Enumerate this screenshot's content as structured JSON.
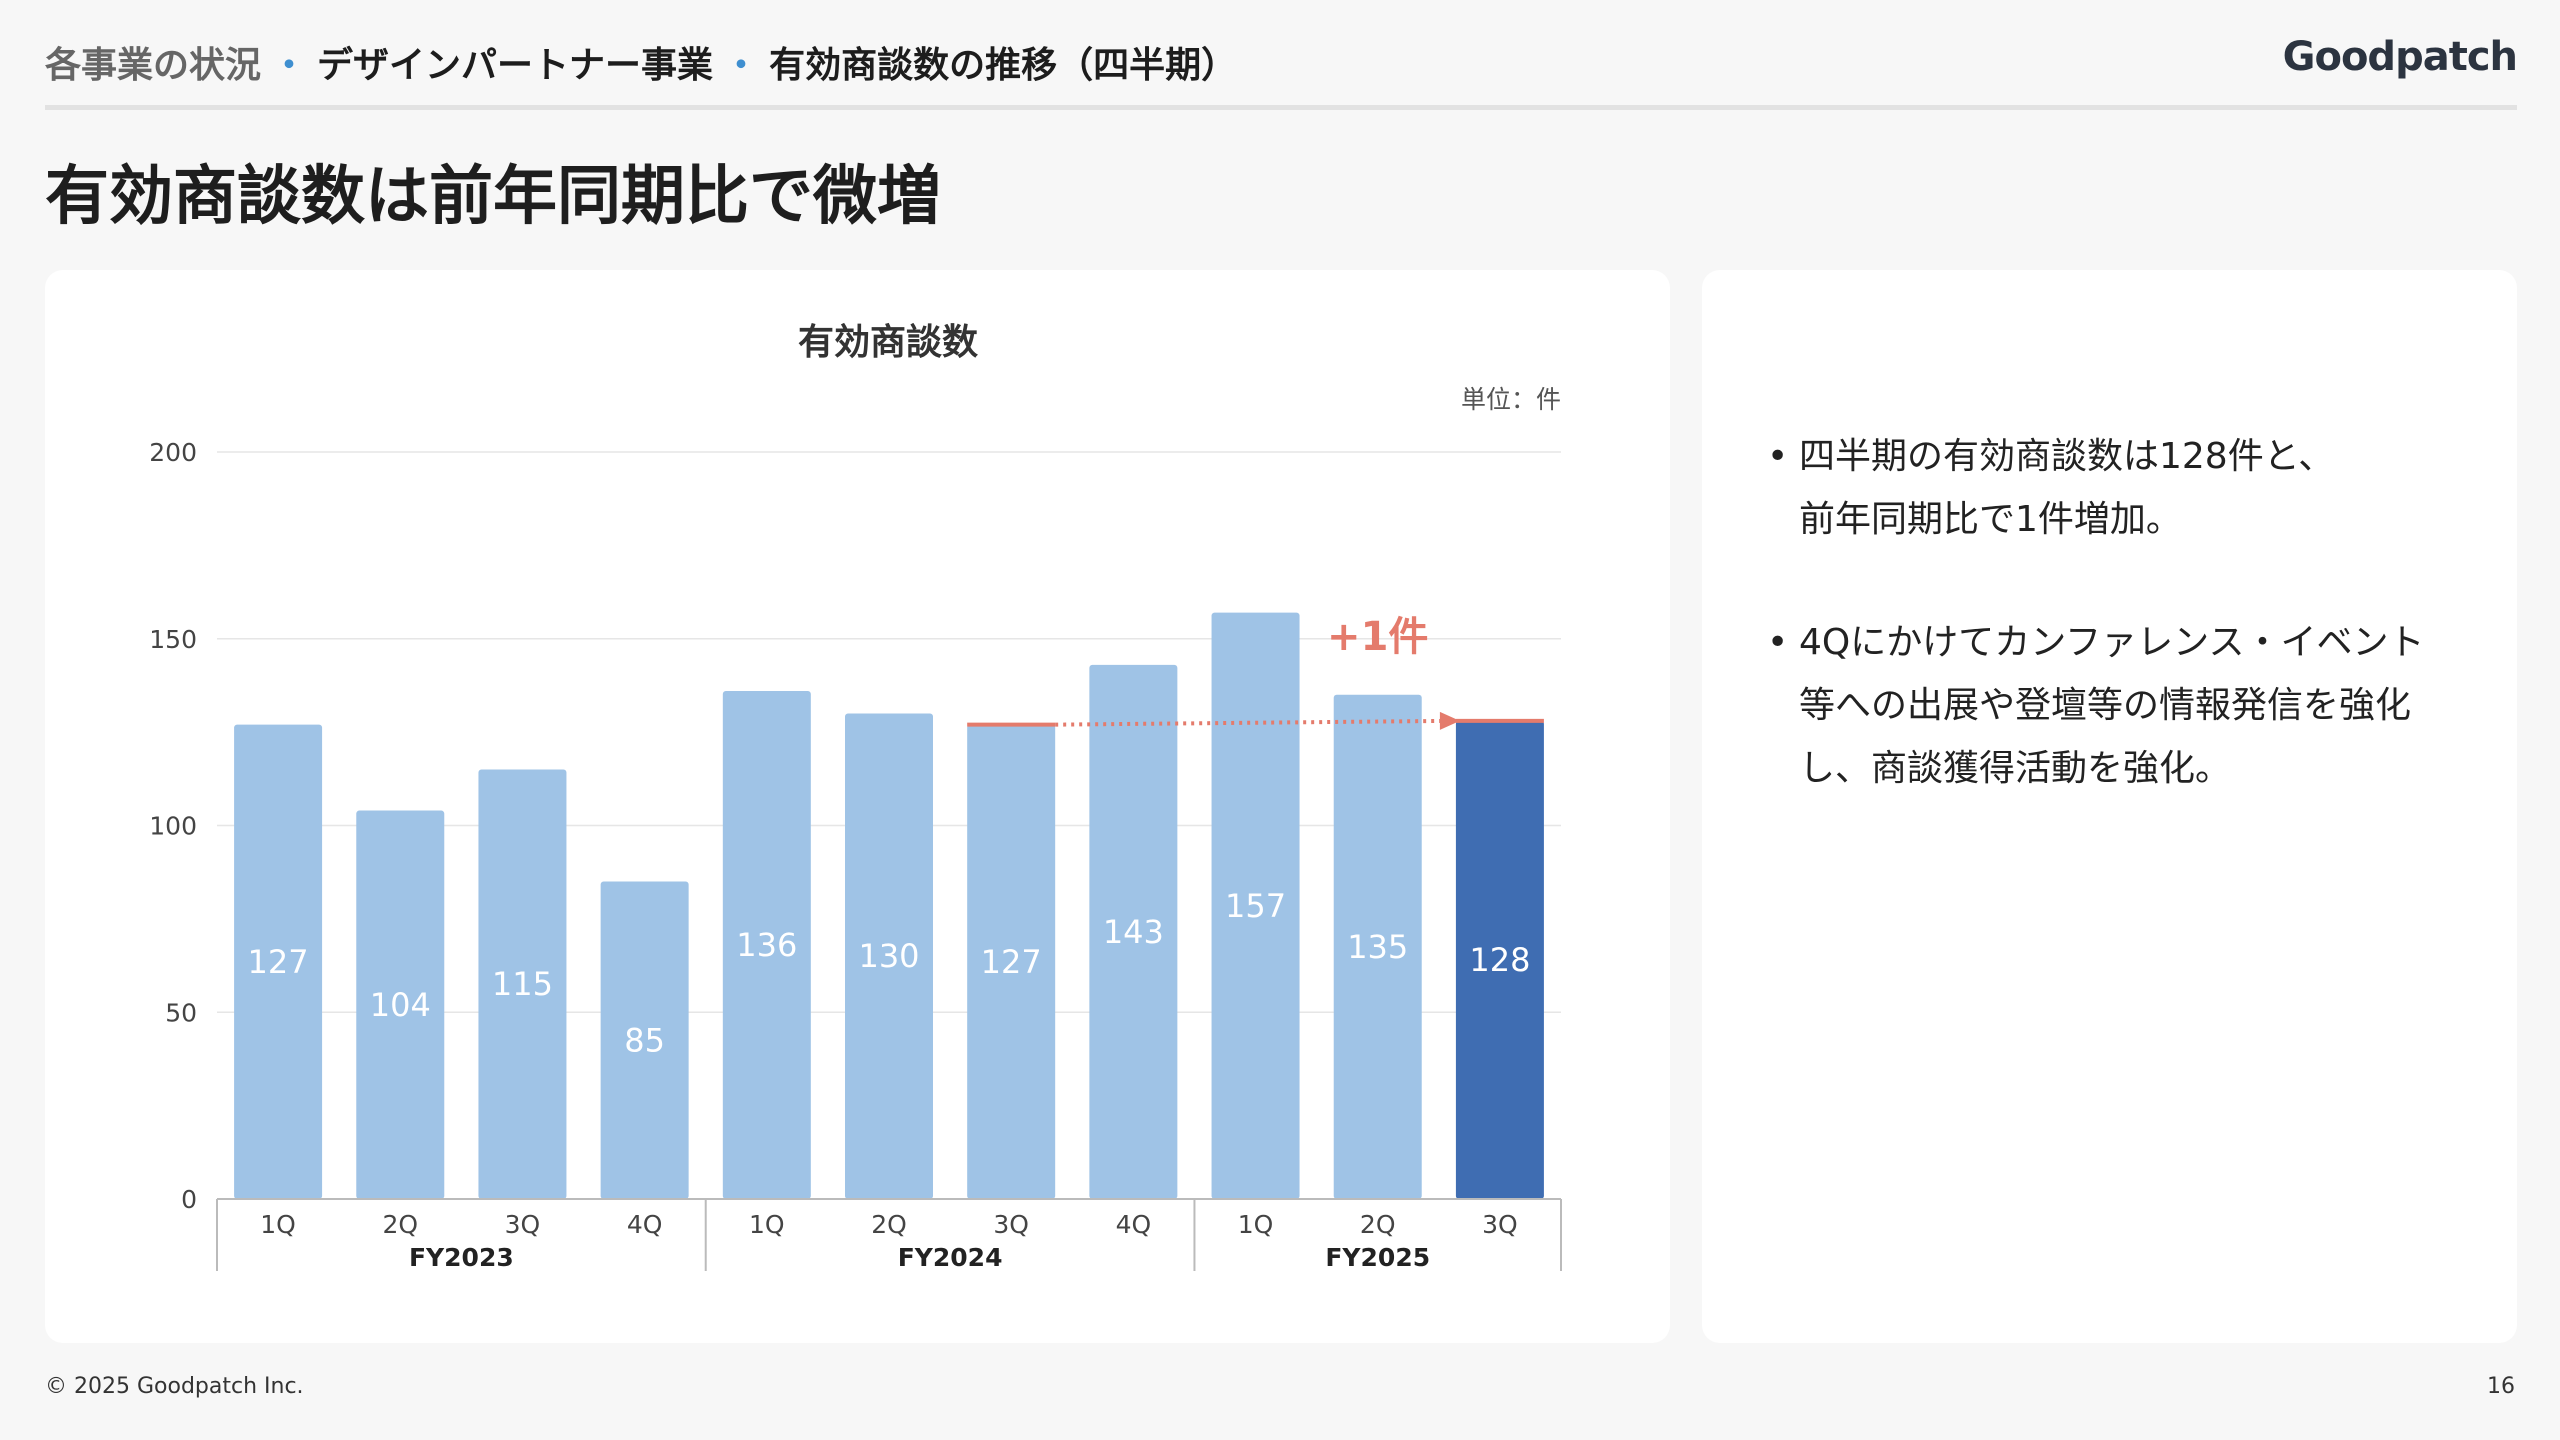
{
  "header": {
    "breadcrumb": [
      "各事業の状況",
      "デザインパートナー事業",
      "有効商談数の推移（四半期）"
    ],
    "separator": "・",
    "logo": "Goodpatch"
  },
  "headline": "有効商談数は前年同期比で微増",
  "chart_data": {
    "type": "bar",
    "title": "有効商談数",
    "unit_label": "単位：件",
    "categories": [
      "1Q",
      "2Q",
      "3Q",
      "4Q",
      "1Q",
      "2Q",
      "3Q",
      "4Q",
      "1Q",
      "2Q",
      "3Q"
    ],
    "groups": [
      {
        "label": "FY2023",
        "count": 4
      },
      {
        "label": "FY2024",
        "count": 4
      },
      {
        "label": "FY2025",
        "count": 3
      }
    ],
    "values": [
      127,
      104,
      115,
      85,
      136,
      130,
      127,
      143,
      157,
      135,
      128
    ],
    "highlight_index": 10,
    "colors": {
      "bar": "#9fc3e6",
      "highlight": "#3f6db2",
      "annotation": "#e47b6c",
      "grid": "#e6e6e6"
    },
    "ylim": [
      0,
      200
    ],
    "yticks": [
      0,
      50,
      100,
      150,
      200
    ],
    "annotation": {
      "text": "+1件",
      "from_index": 6,
      "to_index": 10
    },
    "grid": true,
    "legend": "none"
  },
  "bullets": [
    {
      "lines": [
        "四半期の有効商談数は128件と、",
        "前年同期比で1件増加。"
      ]
    },
    {
      "lines": [
        "4Qにかけてカンファレンス・イベント",
        "等への出展や登壇等の情報発信を強化",
        "し、商談獲得活動を強化。"
      ]
    }
  ],
  "footer": {
    "copyright": "© 2025 Goodpatch Inc.",
    "page_number": "16"
  }
}
